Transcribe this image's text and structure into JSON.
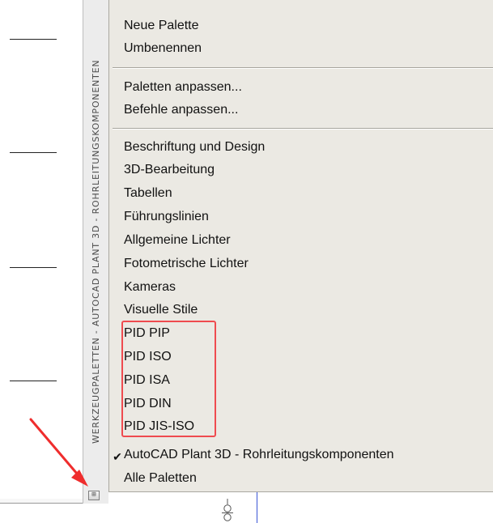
{
  "tool_palette": {
    "title": "WERKZEUGPALETTEN - AUTOCAD PLANT 3D - ROHRLEITUNGSKOMPONENTEN",
    "properties_icon": "palette-properties-icon"
  },
  "context_menu": {
    "items": [
      {
        "label": "Neue Palette"
      },
      {
        "label": "Umbenennen"
      },
      {
        "label": "Paletten anpassen..."
      },
      {
        "label": "Befehle anpassen..."
      },
      {
        "label": "Beschriftung und Design"
      },
      {
        "label": "3D-Bearbeitung"
      },
      {
        "label": "Tabellen"
      },
      {
        "label": "Führungslinien"
      },
      {
        "label": "Allgemeine Lichter"
      },
      {
        "label": "Fotometrische Lichter"
      },
      {
        "label": "Kameras"
      },
      {
        "label": "Visuelle Stile"
      },
      {
        "label": "PID PIP"
      },
      {
        "label": "PID ISO"
      },
      {
        "label": "PID ISA"
      },
      {
        "label": "PID DIN"
      },
      {
        "label": "PID JIS-ISO"
      },
      {
        "label": "AutoCAD Plant 3D - Rohrleitungskomponenten",
        "checked": true
      },
      {
        "label": "Alle Paletten"
      }
    ],
    "check_glyph": "✔"
  },
  "annotation": {
    "highlight_color": "#ef4b4f",
    "arrow_color": "#ef2d2d"
  }
}
